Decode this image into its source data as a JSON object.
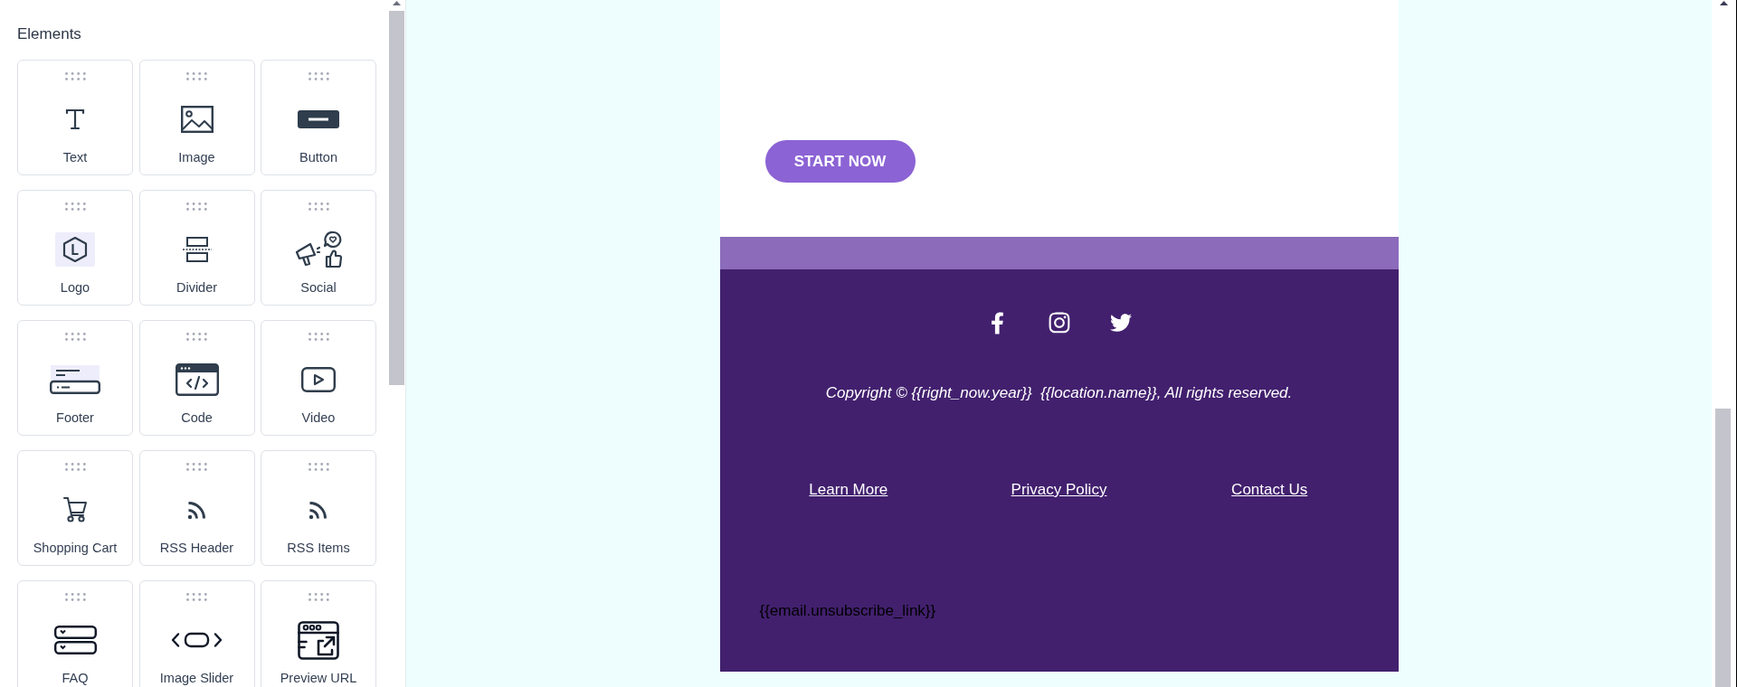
{
  "sidebar": {
    "title": "Elements",
    "items": [
      "Text",
      "Image",
      "Button",
      "Logo",
      "Divider",
      "Social",
      "Footer",
      "Code",
      "Video",
      "Shopping Cart",
      "RSS Header",
      "RSS Items",
      "FAQ",
      "Image Slider",
      "Preview URL"
    ]
  },
  "email": {
    "cta_button": "START NOW",
    "copyright": "Copyright © {{right_now.year}}  {{location.name}}, All rights reserved.",
    "links": [
      "Learn More",
      "Privacy Policy",
      "Contact Us"
    ],
    "unsubscribe_link": "{{email.unsubscribe_link}}"
  }
}
